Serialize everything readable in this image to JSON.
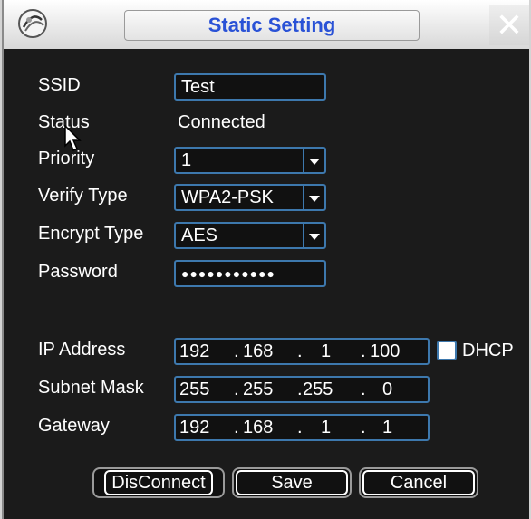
{
  "dialog": {
    "title": "Static Setting",
    "close_glyph": "✕"
  },
  "fields": {
    "ssid": {
      "label": "SSID",
      "value": "Test"
    },
    "status": {
      "label": "Status",
      "value": "Connected"
    },
    "priority": {
      "label": "Priority",
      "value": "1"
    },
    "verify_type": {
      "label": "Verify Type",
      "value": "WPA2-PSK"
    },
    "encrypt_type": {
      "label": "Encrypt Type",
      "value": "AES"
    },
    "password": {
      "label": "Password",
      "value": "●●●●●●●●●●●"
    },
    "ip_address": {
      "label": "IP Address",
      "octets": [
        "192",
        "168",
        "1",
        "100"
      ]
    },
    "subnet_mask": {
      "label": "Subnet Mask",
      "octets": [
        "255",
        "255",
        "255",
        "0"
      ]
    },
    "gateway": {
      "label": "Gateway",
      "octets": [
        "192",
        "168",
        "1",
        "1"
      ]
    }
  },
  "dhcp": {
    "label": "DHCP",
    "checked": false
  },
  "buttons": {
    "disconnect": "DisConnect",
    "save": "Save",
    "cancel": "Cancel"
  },
  "icons": {
    "logo": "logo-icon",
    "close": "close-icon",
    "dropdown": "chevron-down-icon",
    "cursor": "cursor-icon"
  },
  "colors": {
    "title_text": "#2a52d6",
    "field_border": "#3d78ad",
    "background": "#1b1b1b"
  }
}
